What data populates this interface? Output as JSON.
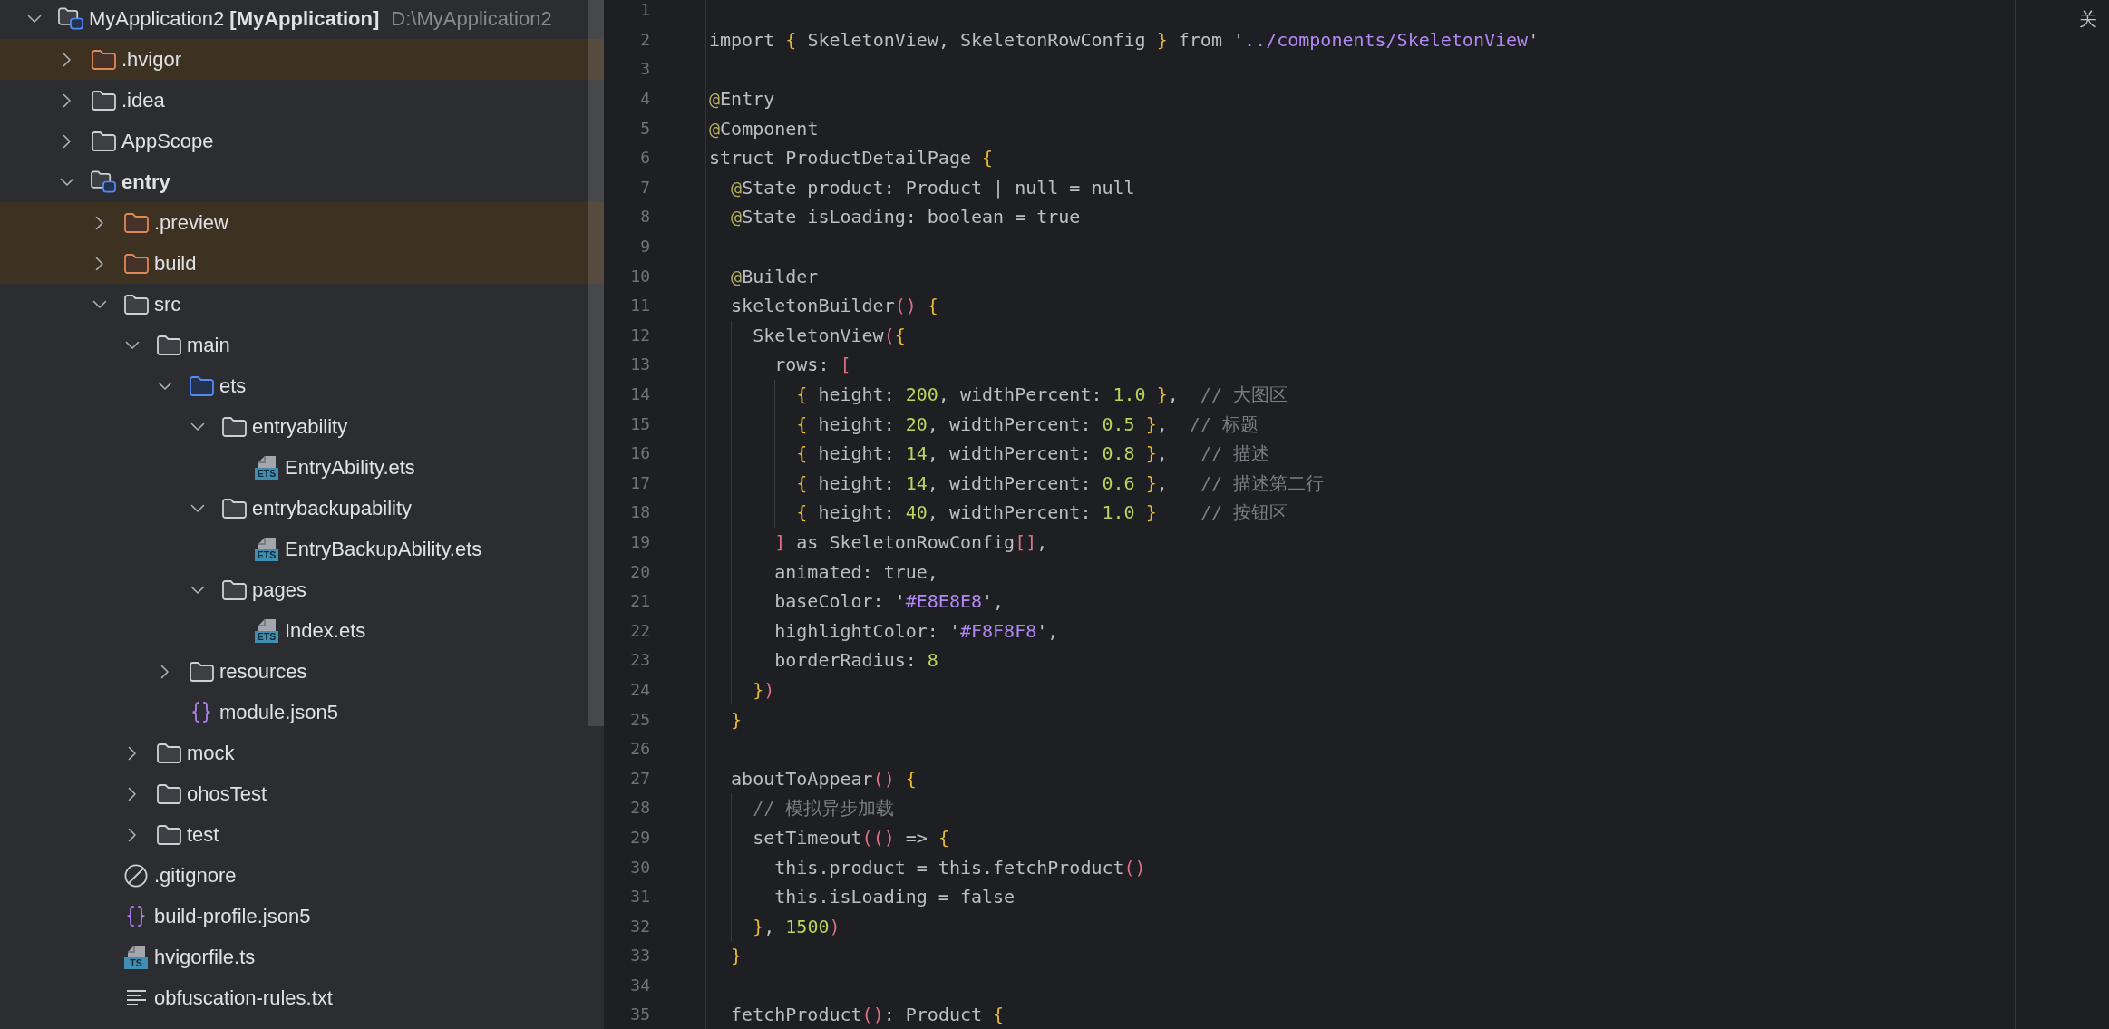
{
  "project_tree": [
    {
      "kind": "project",
      "label": "MyApplication2 **[MyApplication]**",
      "location": "D:\\MyApplication2",
      "expanded": true,
      "children": [
        {
          "kind": "excluded",
          "label": ".hvigor",
          "expanded": false
        },
        {
          "kind": "folder",
          "label": ".idea",
          "expanded": false
        },
        {
          "kind": "folder",
          "label": "AppScope",
          "expanded": false
        },
        {
          "kind": "module",
          "label": "entry",
          "expanded": true,
          "children": [
            {
              "kind": "excluded",
              "label": ".preview",
              "expanded": false
            },
            {
              "kind": "excluded",
              "label": "build",
              "expanded": false
            },
            {
              "kind": "folder",
              "label": "src",
              "expanded": true,
              "children": [
                {
                  "kind": "folder",
                  "label": "main",
                  "expanded": true,
                  "children": [
                    {
                      "kind": "sources",
                      "label": "ets",
                      "expanded": true,
                      "children": [
                        {
                          "kind": "folder",
                          "label": "entryability",
                          "expanded": true,
                          "children": [
                            {
                              "kind": "ets",
                              "label": "EntryAbility.ets",
                              "badge": "ETS"
                            }
                          ]
                        },
                        {
                          "kind": "folder",
                          "label": "entrybackupability",
                          "expanded": true,
                          "children": [
                            {
                              "kind": "ets",
                              "label": "EntryBackupAbility.ets",
                              "badge": "ETS"
                            }
                          ]
                        },
                        {
                          "kind": "folder",
                          "label": "pages",
                          "expanded": true,
                          "children": [
                            {
                              "kind": "ets",
                              "label": "Index.ets",
                              "badge": "ETS"
                            }
                          ]
                        }
                      ]
                    },
                    {
                      "kind": "folder",
                      "label": "resources",
                      "expanded": false
                    },
                    {
                      "kind": "json",
                      "label": "module.json5"
                    }
                  ]
                },
                {
                  "kind": "folder",
                  "label": "mock",
                  "expanded": false
                },
                {
                  "kind": "folder",
                  "label": "ohosTest",
                  "expanded": false
                },
                {
                  "kind": "folder",
                  "label": "test",
                  "expanded": false
                }
              ]
            },
            {
              "kind": "gitignore",
              "label": ".gitignore"
            },
            {
              "kind": "json",
              "label": "build-profile.json5"
            },
            {
              "kind": "ts",
              "label": "hvigorfile.ts",
              "badge": "TS"
            },
            {
              "kind": "text",
              "label": "obfuscation-rules.txt"
            }
          ]
        }
      ]
    }
  ],
  "editor": {
    "lines": [
      {
        "number": "1"
      },
      {
        "number": "2",
        "text": "import { SkeletonView, SkeletonRowConfig } from '../components/SkeletonView'"
      },
      {
        "number": "3"
      },
      {
        "number": "4",
        "text": "@Entry"
      },
      {
        "number": "5",
        "text": "@Component"
      },
      {
        "number": "6",
        "text": "struct ProductDetailPage {"
      },
      {
        "number": "7",
        "text": "  @State product: Product | null = null"
      },
      {
        "number": "8",
        "text": "  @State isLoading: boolean = true"
      },
      {
        "number": "9"
      },
      {
        "number": "10",
        "text": "  @Builder"
      },
      {
        "number": "11",
        "text": "  skeletonBuilder() {"
      },
      {
        "number": "12",
        "text": "    SkeletonView({"
      },
      {
        "number": "13",
        "text": "      rows: ["
      },
      {
        "number": "14",
        "text": "        { height: 200, widthPercent: 1.0 },  // 大图区"
      },
      {
        "number": "15",
        "text": "        { height: 20, widthPercent: 0.5 },  // 标题"
      },
      {
        "number": "16",
        "text": "        { height: 14, widthPercent: 0.8 },   // 描述"
      },
      {
        "number": "17",
        "text": "        { height: 14, widthPercent: 0.6 },   // 描述第二行"
      },
      {
        "number": "18",
        "text": "        { height: 40, widthPercent: 1.0 }    // 按钮区"
      },
      {
        "number": "19",
        "text": "      ] as SkeletonRowConfig[],"
      },
      {
        "number": "20",
        "text": "      animated: true,"
      },
      {
        "number": "21",
        "text": "      baseColor: '#E8E8E8',"
      },
      {
        "number": "22",
        "text": "      highlightColor: '#F8F8F8',"
      },
      {
        "number": "23",
        "text": "      borderRadius: 8"
      },
      {
        "number": "24",
        "text": "    })"
      },
      {
        "number": "25",
        "text": "  }"
      },
      {
        "number": "26"
      },
      {
        "number": "27",
        "text": "  aboutToAppear() {"
      },
      {
        "number": "28",
        "text": "    // 模拟异步加载"
      },
      {
        "number": "29",
        "text": "    setTimeout(() => {"
      },
      {
        "number": "30",
        "text": "      this.product = this.fetchProduct()"
      },
      {
        "number": "31",
        "text": "      this.isLoading = false"
      },
      {
        "number": "32",
        "text": "    }, 1500)"
      },
      {
        "number": "33",
        "text": "  }"
      },
      {
        "number": "34"
      },
      {
        "number": "35",
        "text": "  fetchProduct(): Product {"
      }
    ]
  },
  "right_panel": {
    "button": "关"
  }
}
